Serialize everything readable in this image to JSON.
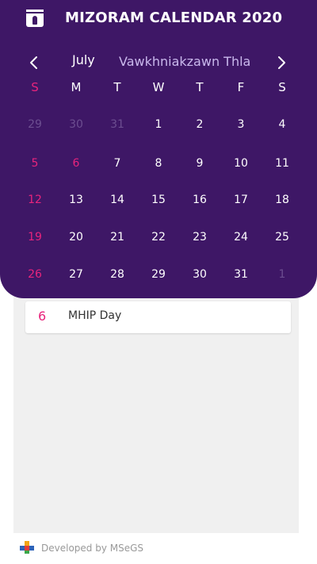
{
  "app": {
    "title": "MIZORAM CALENDAR 2020"
  },
  "nav": {
    "month": "July",
    "mizo_month": "Vawkhniakzawn  Thla"
  },
  "weekdays": [
    "S",
    "M",
    "T",
    "W",
    "T",
    "F",
    "S"
  ],
  "weeks": [
    [
      "29",
      "30",
      "31",
      "1",
      "2",
      "3",
      "4"
    ],
    [
      "5",
      "6",
      "7",
      "8",
      "9",
      "10",
      "11"
    ],
    [
      "12",
      "13",
      "14",
      "15",
      "16",
      "17",
      "18"
    ],
    [
      "19",
      "20",
      "21",
      "22",
      "23",
      "24",
      "25"
    ],
    [
      "26",
      "27",
      "28",
      "29",
      "30",
      "31",
      "1"
    ]
  ],
  "events": [
    {
      "day": "6",
      "name": "MHIP Day"
    }
  ],
  "footer": {
    "text": "Developed by MSeGS"
  },
  "colors": {
    "header": "#3e1766",
    "accent": "#e8247c",
    "muted": "#6c4e90",
    "mizo": "#c9b8ec"
  }
}
